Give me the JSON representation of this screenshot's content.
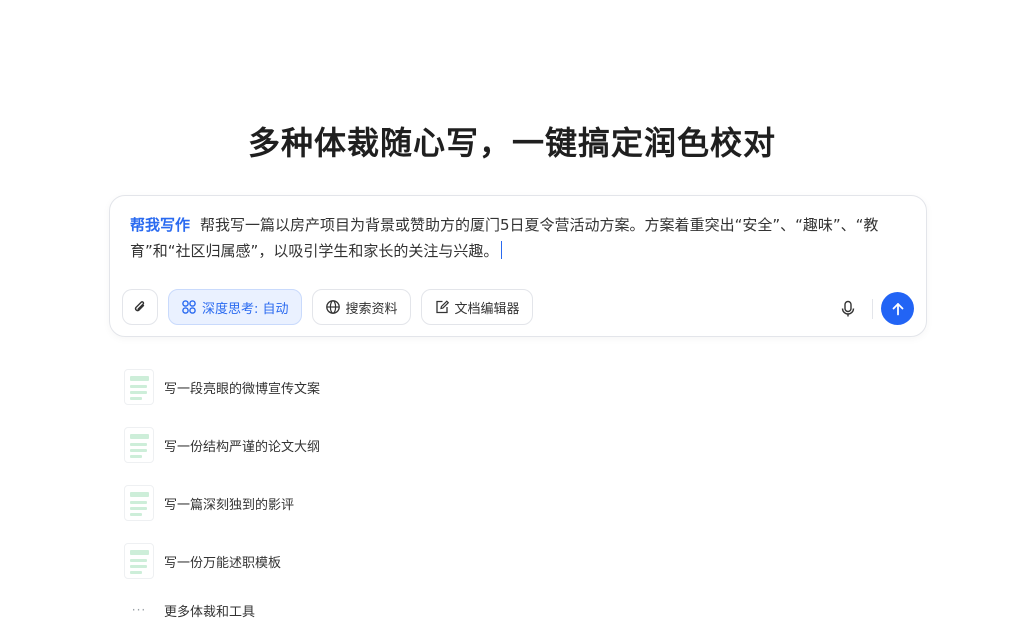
{
  "headline": "多种体裁随心写，一键搞定润色校对",
  "composer": {
    "skill_tag": "帮我写作",
    "input_text": "帮我写一篇以房产项目为背景或赞助方的厦门5日夏令营活动方案。方案着重突出“安全”、“趣味”、“教育”和“社区归属感”，以吸引学生和家长的关注与兴趣。",
    "toolbar": {
      "attach_icon": "paperclip-icon",
      "deep_think_label": "深度思考: 自动",
      "search_label": "搜索资料",
      "doc_editor_label": "文档编辑器",
      "mic_icon": "microphone-icon",
      "send_icon": "arrow-up-icon"
    },
    "accent_color": "#2264f5"
  },
  "suggestions": [
    {
      "label": "写一段亮眼的微博宣传文案"
    },
    {
      "label": "写一份结构严谨的论文大纲"
    },
    {
      "label": "写一篇深刻独到的影评"
    },
    {
      "label": "写一份万能述职模板"
    }
  ],
  "more": {
    "dots": "···",
    "label": "更多体裁和工具"
  }
}
